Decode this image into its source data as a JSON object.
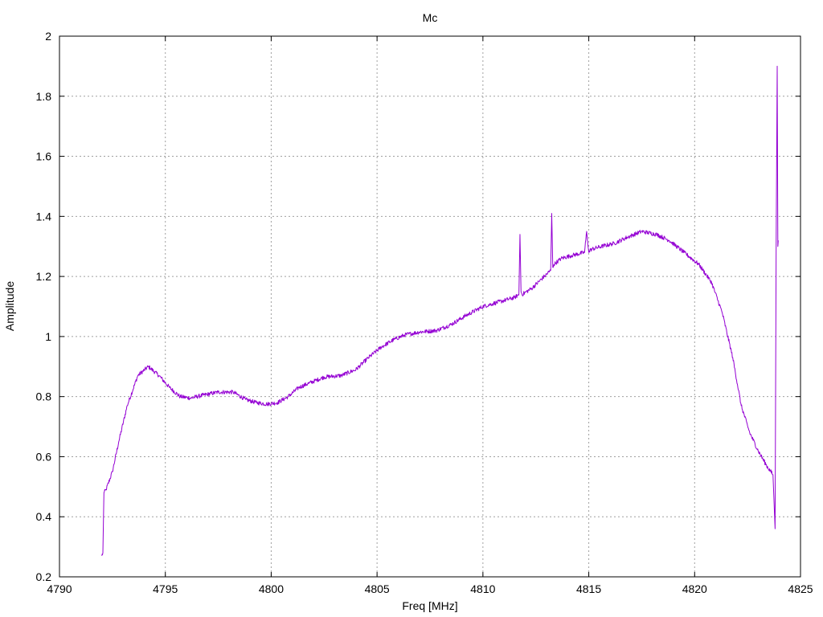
{
  "chart_data": {
    "type": "line",
    "title": "Mc",
    "xlabel": "Freq [MHz]",
    "ylabel": "Amplitude",
    "xlim": [
      4790,
      4825
    ],
    "ylim": [
      0.2,
      2
    ],
    "xticks": [
      4790,
      4795,
      4800,
      4805,
      4810,
      4815,
      4820,
      4825
    ],
    "yticks": [
      0.2,
      0.4,
      0.6,
      0.8,
      1,
      1.2,
      1.4,
      1.6,
      1.8,
      2
    ],
    "xtick_labels": [
      "4790",
      "4795",
      "4800",
      "4805",
      "4810",
      "4815",
      "4820",
      "4825"
    ],
    "ytick_labels": [
      "0.2",
      "0.4",
      "0.6",
      "0.8",
      "1",
      "1.2",
      "1.4",
      "1.6",
      "1.8",
      "2"
    ],
    "grid": true,
    "series": [
      {
        "color": "#9400d3",
        "x": [
          4792.0,
          4792.05,
          4792.1,
          4792.2,
          4792.5,
          4792.8,
          4793.2,
          4793.7,
          4794.2,
          4794.7,
          4795.2,
          4795.7,
          4796.2,
          4796.8,
          4797.5,
          4798.2,
          4798.8,
          4799.3,
          4799.8,
          4800.3,
          4800.8,
          4801.3,
          4801.8,
          4802.5,
          4803.3,
          4804.0,
          4804.6,
          4805.2,
          4805.8,
          4806.3,
          4807.0,
          4807.8,
          4808.5,
          4809.2,
          4810.0,
          4810.5,
          4811.0,
          4811.5,
          4811.7,
          4811.75,
          4811.8,
          4811.85,
          4812.3,
          4812.9,
          4813.2,
          4813.25,
          4813.3,
          4813.35,
          4813.7,
          4814.2,
          4814.8,
          4814.9,
          4815.0,
          4815.1,
          4815.6,
          4816.2,
          4816.8,
          4817.5,
          4818.2,
          4818.8,
          4819.5,
          4820.2,
          4820.8,
          4821.3,
          4821.8,
          4822.2,
          4822.6,
          4823.0,
          4823.4,
          4823.7,
          4823.8,
          4823.85,
          4823.9,
          4823.93,
          4823.95
        ],
        "y": [
          0.27,
          0.28,
          0.48,
          0.49,
          0.55,
          0.65,
          0.77,
          0.87,
          0.9,
          0.87,
          0.83,
          0.8,
          0.795,
          0.805,
          0.815,
          0.815,
          0.79,
          0.78,
          0.775,
          0.78,
          0.8,
          0.83,
          0.845,
          0.865,
          0.87,
          0.89,
          0.93,
          0.965,
          0.99,
          1.005,
          1.015,
          1.02,
          1.04,
          1.07,
          1.1,
          1.11,
          1.12,
          1.13,
          1.14,
          1.34,
          1.15,
          1.14,
          1.16,
          1.2,
          1.22,
          1.41,
          1.23,
          1.24,
          1.26,
          1.27,
          1.28,
          1.35,
          1.28,
          1.29,
          1.3,
          1.31,
          1.33,
          1.35,
          1.34,
          1.32,
          1.28,
          1.24,
          1.18,
          1.08,
          0.93,
          0.77,
          0.68,
          0.62,
          0.57,
          0.54,
          0.36,
          1.3,
          1.9,
          1.3,
          1.32
        ]
      }
    ]
  }
}
